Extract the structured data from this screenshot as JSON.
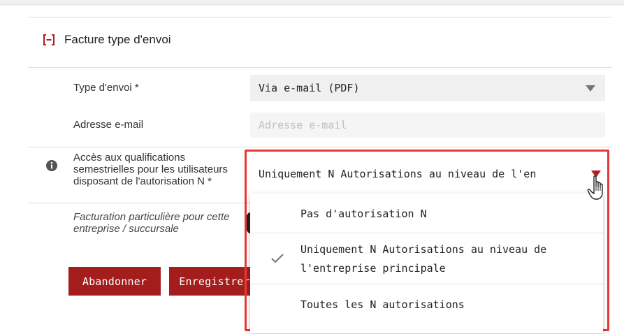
{
  "section": {
    "title": "Facture type d'envoi"
  },
  "fields": {
    "type_envoi": {
      "label": "Type d'envoi *",
      "value": "Via e-mail (PDF)"
    },
    "email": {
      "label": "Adresse e-mail",
      "placeholder": "Adresse e-mail",
      "value": ""
    },
    "acces": {
      "label_lines": [
        "Accès aux qualifications",
        "semestrielles pour les utilisateurs",
        "disposant de l'autorisation N *"
      ],
      "value": "Uniquement N Autorisations au niveau de l'en"
    },
    "facturation": {
      "label_lines": [
        "Facturation particulière pour cette",
        "entreprise / succursale"
      ]
    }
  },
  "dropdown": {
    "options": [
      {
        "lines": [
          "Pas d'autorisation N"
        ],
        "selected": false
      },
      {
        "lines": [
          "Uniquement N Autorisations au niveau de",
          "l'entreprise principale"
        ],
        "selected": true
      },
      {
        "lines": [
          "Toutes les N autorisations"
        ],
        "selected": false
      }
    ]
  },
  "buttons": {
    "cancel": "Abandonner",
    "save": "Enregistrer"
  },
  "colors": {
    "accent": "#a41d1d",
    "highlight": "#e53935"
  },
  "icons": {
    "collapse": "minus-square-icon",
    "info": "info-circle-icon",
    "check": "check-icon",
    "pointer": "hand-pointer-icon"
  }
}
